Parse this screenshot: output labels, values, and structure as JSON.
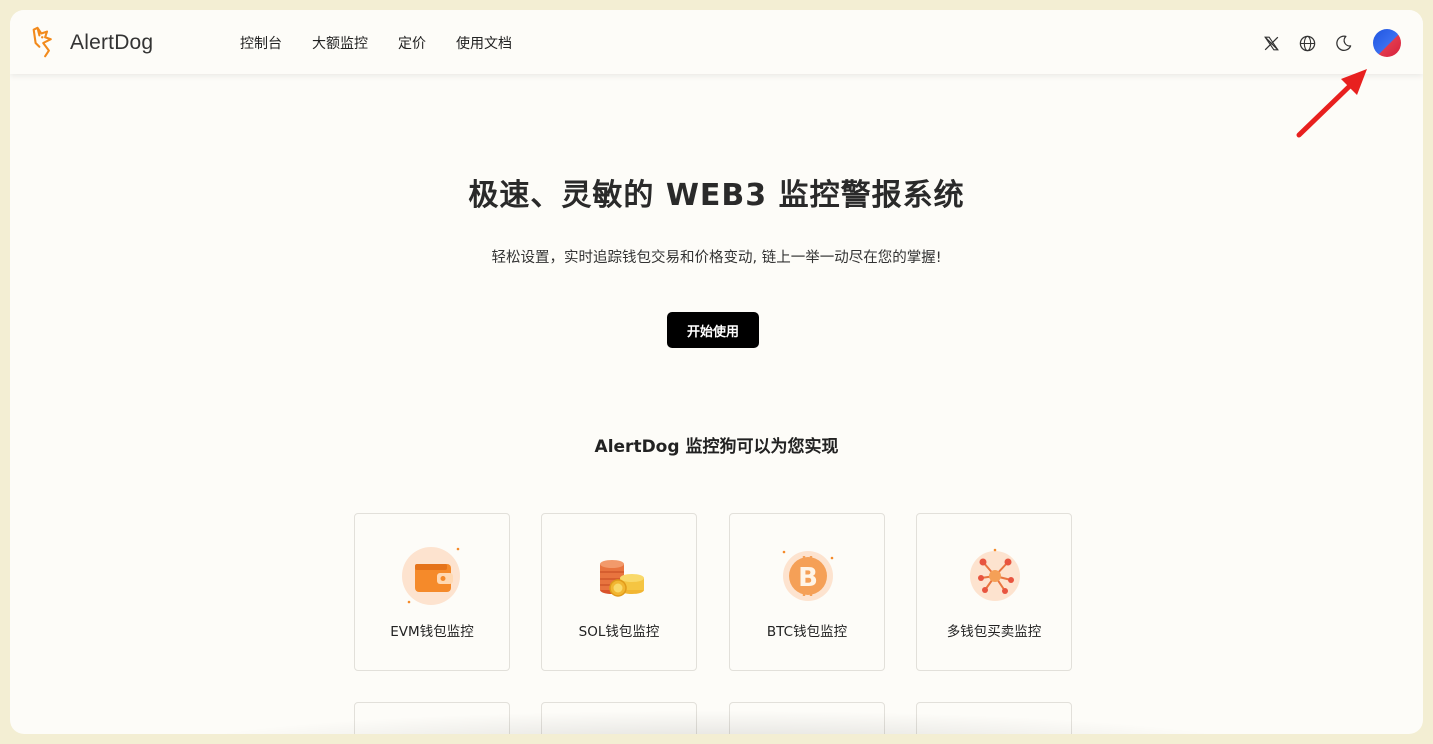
{
  "brand": {
    "name_part1": "Alert",
    "name_part2": "Dog",
    "color": "#f28a1c"
  },
  "nav": {
    "items": [
      {
        "label": "控制台"
      },
      {
        "label": "大额监控"
      },
      {
        "label": "定价"
      },
      {
        "label": "使用文档"
      }
    ]
  },
  "header_icons": [
    "x-icon",
    "globe-icon",
    "moon-icon",
    "avatar"
  ],
  "hero": {
    "title": "极速、灵敏的 WEB3 监控警报系统",
    "subtitle": "轻松设置，实时追踪钱包交易和价格变动, 链上一举一动尽在您的掌握!",
    "cta_label": "开始使用"
  },
  "features": {
    "title": "AlertDog 监控狗可以为您实现",
    "items": [
      {
        "label": "EVM钱包监控",
        "icon": "wallet-icon"
      },
      {
        "label": "SOL钱包监控",
        "icon": "coins-icon"
      },
      {
        "label": "BTC钱包监控",
        "icon": "bitcoin-icon"
      },
      {
        "label": "多钱包买卖监控",
        "icon": "network-icon"
      }
    ]
  },
  "colors": {
    "accent": "#f28a1c",
    "annotation_arrow": "#e8201f",
    "background": "#fdfcf8"
  }
}
